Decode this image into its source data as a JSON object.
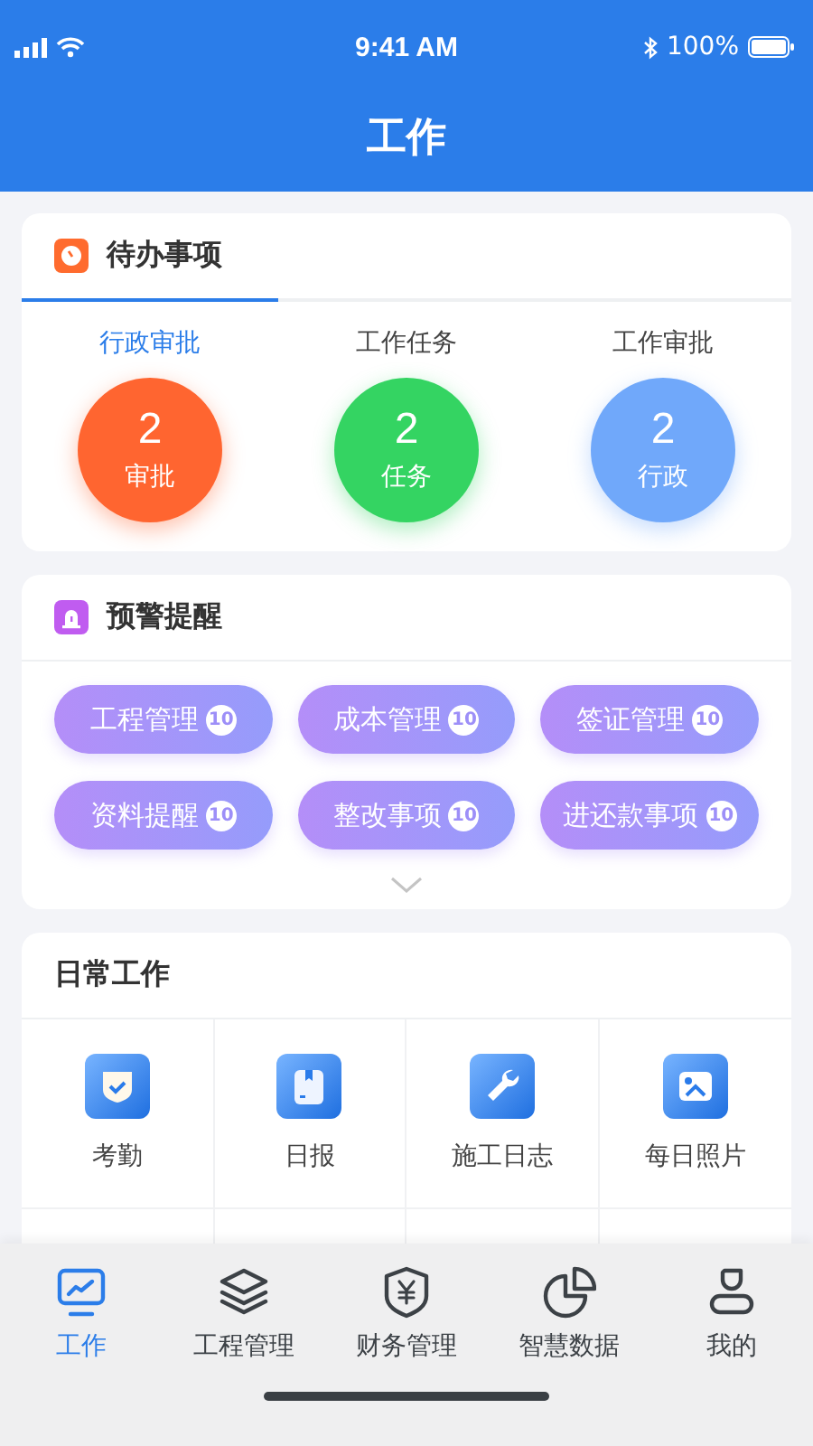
{
  "status_bar": {
    "time": "9:41 AM",
    "battery": "100%"
  },
  "header": {
    "title": "工作"
  },
  "todo": {
    "title": "待办事项",
    "tabs": [
      {
        "label": "行政审批",
        "selected": true,
        "count": "2",
        "caption": "审批",
        "color": "#ff6530"
      },
      {
        "label": "工作任务",
        "selected": false,
        "count": "2",
        "caption": "任务",
        "color": "#34d462"
      },
      {
        "label": "工作审批",
        "selected": false,
        "count": "2",
        "caption": "行政",
        "color": "#70a8fa"
      }
    ]
  },
  "alerts": {
    "title": "预警提醒",
    "tags": [
      {
        "label": "工程管理",
        "badge": "10"
      },
      {
        "label": "成本管理",
        "badge": "10"
      },
      {
        "label": "签证管理",
        "badge": "10"
      },
      {
        "label": "资料提醒",
        "badge": "10"
      },
      {
        "label": "整改事项",
        "badge": "10"
      },
      {
        "label": "进还款事项",
        "badge": "10"
      }
    ]
  },
  "daily": {
    "title": "日常工作",
    "items": [
      {
        "label": "考勤",
        "kind": "shield"
      },
      {
        "label": "日报",
        "kind": "document"
      },
      {
        "label": "施工日志",
        "kind": "wrench"
      },
      {
        "label": "每日照片",
        "kind": "image"
      }
    ]
  },
  "tab_bar": [
    {
      "label": "工作",
      "kind": "monitor",
      "selected": true
    },
    {
      "label": "工程管理",
      "kind": "layers",
      "selected": false
    },
    {
      "label": "财务管理",
      "kind": "yen",
      "selected": false
    },
    {
      "label": "智慧数据",
      "kind": "pie",
      "selected": false
    },
    {
      "label": "我的",
      "kind": "person",
      "selected": false
    }
  ]
}
